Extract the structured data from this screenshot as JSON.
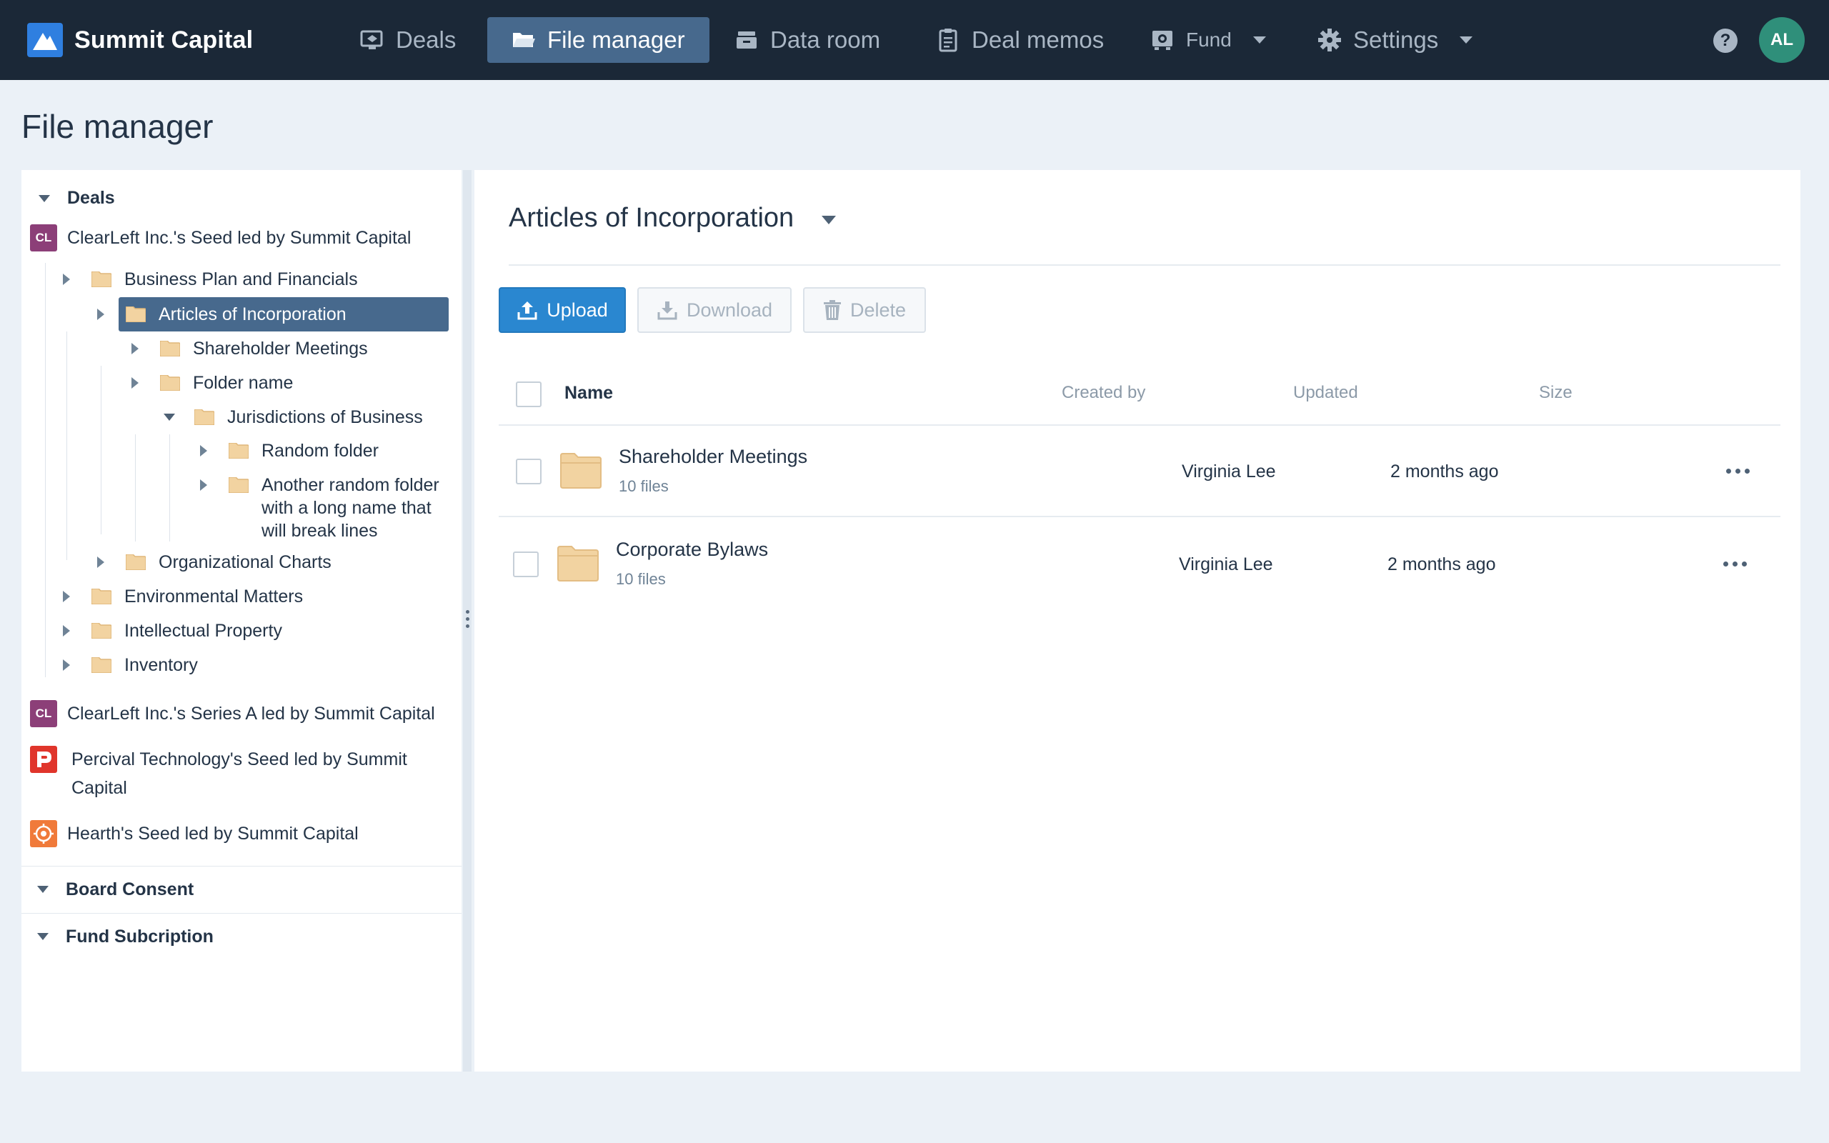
{
  "nav": {
    "brand": "Summit Capital",
    "items": [
      {
        "label": "Deals",
        "icon": "deals-icon"
      },
      {
        "label": "File manager",
        "icon": "folder-open-icon",
        "active": true
      },
      {
        "label": "Data room",
        "icon": "data-room-icon"
      },
      {
        "label": "Deal memos",
        "icon": "clipboard-icon"
      },
      {
        "label": "Fund",
        "icon": "fund-icon"
      },
      {
        "label": "Settings",
        "icon": "gear-icon"
      }
    ],
    "help": "?",
    "avatar": "AL"
  },
  "page": {
    "title": "File manager"
  },
  "sidebar": {
    "sections": {
      "deals": "Deals",
      "board_consent": "Board Consent",
      "fund_subscription": "Fund Subcription"
    },
    "deals": [
      {
        "badge": "CL",
        "label": "ClearLeft Inc.'s Seed led by Summit Capital"
      },
      {
        "badge": "CL",
        "label": "ClearLeft Inc.'s Series A led by Summit Capital"
      },
      {
        "badge": "P",
        "label_line1": "Percival Technology's Seed led by Summit",
        "label_line2": "Capital"
      },
      {
        "badge": "hearth-icon",
        "label": "Hearth's Seed led by Summit Capital"
      }
    ],
    "folders": {
      "business_plan": "Business Plan and Financials",
      "articles": "Articles of Incorporation",
      "shareholder_meetings": "Shareholder Meetings",
      "folder_name": "Folder name",
      "jurisdictions": "Jurisdictions of Business",
      "random_folder": "Random folder",
      "another_line1": "Another random folder",
      "another_line2": "with a long name that",
      "another_line3": "will break lines",
      "org_charts": "Organizational Charts",
      "environmental": "Environmental Matters",
      "ip": "Intellectual Property",
      "inventory": "Inventory"
    }
  },
  "main": {
    "folder_title": "Articles of Incorporation",
    "buttons": {
      "upload": "Upload",
      "download": "Download",
      "delete": "Delete"
    },
    "columns": {
      "name": "Name",
      "created_by": "Created by",
      "updated": "Updated",
      "size": "Size"
    },
    "rows": [
      {
        "name": "Shareholder Meetings",
        "files": "10 files",
        "created_by": "Virginia Lee",
        "updated": "2 months ago"
      },
      {
        "name": "Corporate Bylaws",
        "files": "10 files",
        "created_by": "Virginia Lee",
        "updated": "2 months ago"
      }
    ]
  },
  "colors": {
    "nav_bg": "#1b2837",
    "nav_active": "#47698d",
    "primary": "#2a87d0",
    "folder": "#f2d3a1",
    "badge_cl": "#8c3f78",
    "badge_p": "#e0352b",
    "badge_hearth": "#f07a3a"
  }
}
